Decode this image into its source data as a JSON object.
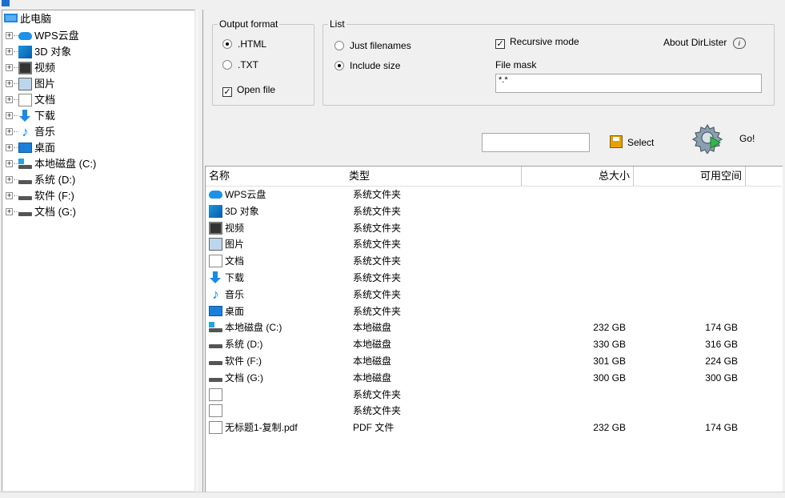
{
  "tree": {
    "root_label": "此电脑",
    "items": [
      {
        "label": "WPS云盘",
        "icon": "cloud-icon"
      },
      {
        "label": "3D 对象",
        "icon": "3d-objects-icon"
      },
      {
        "label": "视频",
        "icon": "video-icon"
      },
      {
        "label": "图片",
        "icon": "picture-icon"
      },
      {
        "label": "文档",
        "icon": "document-icon"
      },
      {
        "label": "下载",
        "icon": "download-icon"
      },
      {
        "label": "音乐",
        "icon": "music-icon"
      },
      {
        "label": "桌面",
        "icon": "desktop-icon"
      },
      {
        "label": "本地磁盘 (C:)",
        "icon": "system-drive-icon"
      },
      {
        "label": "系统 (D:)",
        "icon": "drive-icon"
      },
      {
        "label": "软件 (F:)",
        "icon": "drive-icon"
      },
      {
        "label": "文档 (G:)",
        "icon": "drive-icon"
      }
    ]
  },
  "output_format": {
    "title": "Output format",
    "html": ".HTML",
    "txt": ".TXT",
    "open_file": "Open file",
    "selected": "html",
    "open_file_checked": true
  },
  "list_group": {
    "title": "List",
    "just_filenames": "Just filenames",
    "include_size": "Include size",
    "selected": "include_size",
    "recursive": "Recursive mode",
    "recursive_checked": true,
    "about": "About DirLister",
    "file_mask_label": "File mask",
    "file_mask_value": "*.*"
  },
  "actions": {
    "path_value": "",
    "select_label": "Select",
    "go_label": "Go!"
  },
  "columns": {
    "name": "名称",
    "type": "类型",
    "total": "总大小",
    "free": "可用空间"
  },
  "rows": [
    {
      "name": "WPS云盘",
      "type": "系统文件夹",
      "total": "",
      "free": "",
      "icon": "cloud-icon"
    },
    {
      "name": "3D 对象",
      "type": "系统文件夹",
      "total": "",
      "free": "",
      "icon": "3d-objects-icon"
    },
    {
      "name": "视频",
      "type": "系统文件夹",
      "total": "",
      "free": "",
      "icon": "video-icon"
    },
    {
      "name": "图片",
      "type": "系统文件夹",
      "total": "",
      "free": "",
      "icon": "picture-icon"
    },
    {
      "name": "文档",
      "type": "系统文件夹",
      "total": "",
      "free": "",
      "icon": "document-icon"
    },
    {
      "name": "下载",
      "type": "系统文件夹",
      "total": "",
      "free": "",
      "icon": "download-icon"
    },
    {
      "name": "音乐",
      "type": "系统文件夹",
      "total": "",
      "free": "",
      "icon": "music-icon"
    },
    {
      "name": "桌面",
      "type": "系统文件夹",
      "total": "",
      "free": "",
      "icon": "desktop-icon"
    },
    {
      "name": "本地磁盘 (C:)",
      "type": "本地磁盘",
      "total": "232 GB",
      "free": "174 GB",
      "icon": "system-drive-icon"
    },
    {
      "name": "系统 (D:)",
      "type": "本地磁盘",
      "total": "330 GB",
      "free": "316 GB",
      "icon": "drive-icon"
    },
    {
      "name": "软件 (F:)",
      "type": "本地磁盘",
      "total": "301 GB",
      "free": "224 GB",
      "icon": "drive-icon"
    },
    {
      "name": "文档 (G:)",
      "type": "本地磁盘",
      "total": "300 GB",
      "free": "300 GB",
      "icon": "drive-icon"
    },
    {
      "name": "",
      "type": "系统文件夹",
      "total": "",
      "free": "",
      "icon": "blank-file-icon"
    },
    {
      "name": "",
      "type": "系统文件夹",
      "total": "",
      "free": "",
      "icon": "blank-file-icon"
    },
    {
      "name": "无标题1-复制.pdf",
      "type": "PDF 文件",
      "total": "232 GB",
      "free": "174 GB",
      "icon": "blank-file-icon"
    }
  ]
}
